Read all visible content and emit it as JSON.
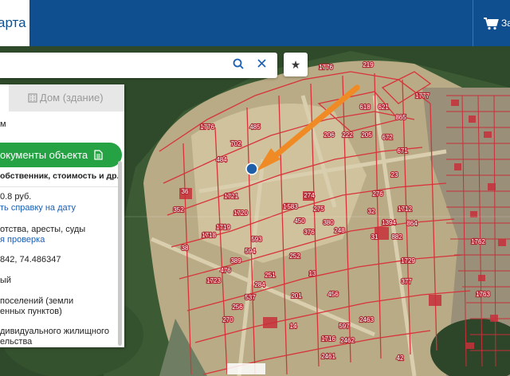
{
  "header": {
    "brand_text": "арта",
    "cart_label": "За"
  },
  "search": {
    "value": "",
    "placeholder": ""
  },
  "panel": {
    "tab_land": "",
    "tab_building": "Дом (здание)",
    "line_area": "м",
    "docs_button": "окументы объекта",
    "docs_sub": "обственник, стоимость и др.",
    "value_line": "0.8 руб.",
    "value_link": "ть справку на дату",
    "restrictions_line": "отства, аресты, суды",
    "restrictions_link": "я проверка",
    "coords": "842, 74.486347",
    "status": "ый",
    "category_1": "поселений (земли",
    "category_2": "енных пунктов)",
    "use_1": "дивидуального жилищного",
    "use_2": "ельства"
  },
  "map": {
    "parcel_labels": [
      "219",
      "1776",
      "1777",
      "1776",
      "485",
      "702",
      "618",
      "621",
      "865",
      "206",
      "222",
      "205",
      "672",
      "671",
      "484",
      "23",
      "276",
      "36",
      "352",
      "1721",
      "1720",
      "1733",
      "274",
      "583",
      "275",
      "450",
      "380",
      "32",
      "1712",
      "31",
      "1394",
      "864",
      "882",
      "1718",
      "1719",
      "593",
      "376",
      "248",
      "38",
      "389",
      "594",
      "252",
      "1729",
      "1723",
      "476",
      "251",
      "284",
      "13",
      "456",
      "201",
      "377",
      "256",
      "537",
      "1762",
      "1763",
      "270",
      "14",
      "597",
      "2462",
      "2463",
      "1716",
      "42",
      "2461"
    ],
    "colors": {
      "parcel_outline": "#d8333b",
      "building": "#c7303a",
      "arrow": "#f08a24",
      "marker": "#1f5fa8"
    },
    "attribution": ""
  },
  "icons": {
    "search": "search-icon",
    "clear": "close-icon",
    "favorite": "star-icon",
    "cart": "cart-icon",
    "building": "building-icon",
    "document": "document-icon"
  }
}
